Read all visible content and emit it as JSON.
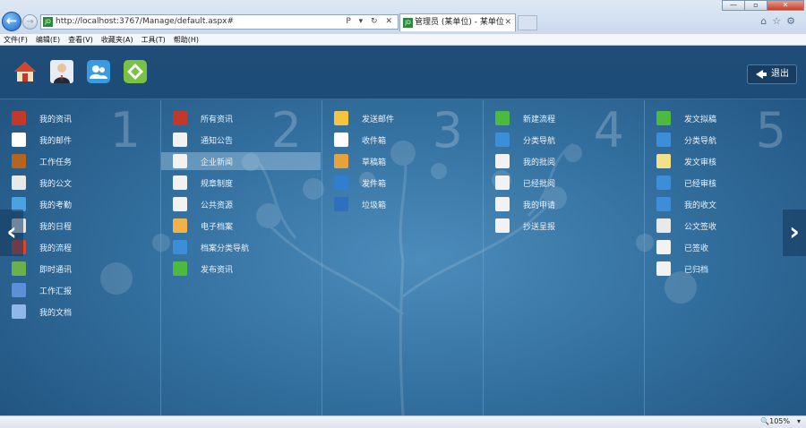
{
  "browser": {
    "address": "http://localhost:3767/Manage/default.aspx#",
    "address_tools": "P ▾ ↻ ✕",
    "tab_title": "管理员 (某单位) - 某单位",
    "tab_close": "✕",
    "favicon": "JD",
    "win_min": "—",
    "win_max": "▫",
    "win_close": "✕",
    "tool_icons": "⌂☆⚙",
    "back": "←",
    "forward": "→",
    "menu": [
      "文件(F)",
      "编辑(E)",
      "查看(V)",
      "收藏夹(A)",
      "工具(T)",
      "帮助(H)"
    ],
    "zoom": "🔍105%",
    "zoom_caret": "▾"
  },
  "app": {
    "exit_label": "退出",
    "prev_arrow": "‹",
    "next_arrow": "›",
    "top_icons": [
      "home-icon",
      "user-avatar-icon",
      "contacts-icon",
      "apps-icon"
    ],
    "columns": [
      {
        "number": "1",
        "items": [
          {
            "label": "我的资讯",
            "icon": "news-icon",
            "color": "#c0392b"
          },
          {
            "label": "我的邮件",
            "icon": "mail-icon",
            "color": "#ffffff"
          },
          {
            "label": "工作任务",
            "icon": "briefcase-icon",
            "color": "#b5651d"
          },
          {
            "label": "我的公文",
            "icon": "document-edit-icon",
            "color": "#e9e9e9"
          },
          {
            "label": "我的考勤",
            "icon": "clock-icon",
            "color": "#4aa3df"
          },
          {
            "label": "我的日程",
            "icon": "calendar-icon",
            "color": "#dfe6ee"
          },
          {
            "label": "我的流程",
            "icon": "flow-icon",
            "color": "#d14836"
          },
          {
            "label": "即时通讯",
            "icon": "chat-icon",
            "color": "#6ab04c"
          },
          {
            "label": "工作汇报",
            "icon": "report-icon",
            "color": "#5b8fd6"
          },
          {
            "label": "我的文档",
            "icon": "files-icon",
            "color": "#8fb8e8"
          }
        ]
      },
      {
        "number": "2",
        "items": [
          {
            "label": "所有资讯",
            "icon": "news-icon",
            "color": "#c0392b"
          },
          {
            "label": "通知公告",
            "icon": "notice-icon",
            "color": "#f2f2f2"
          },
          {
            "label": "企业新闻",
            "icon": "news-page-icon",
            "color": "#f2f2f2",
            "selected": true
          },
          {
            "label": "规章制度",
            "icon": "rules-icon",
            "color": "#f2f2f2"
          },
          {
            "label": "公共资源",
            "icon": "resource-icon",
            "color": "#f2f2f2"
          },
          {
            "label": "电子档案",
            "icon": "archive-icon",
            "color": "#f0b24a"
          },
          {
            "label": "档案分类导航",
            "icon": "archive-nav-icon",
            "color": "#3d8ed8"
          },
          {
            "label": "发布资讯",
            "icon": "add-icon",
            "color": "#4cba3e"
          }
        ]
      },
      {
        "number": "3",
        "items": [
          {
            "label": "发送邮件",
            "icon": "send-mail-icon",
            "color": "#f5c542"
          },
          {
            "label": "收件箱",
            "icon": "inbox-icon",
            "color": "#ffffff"
          },
          {
            "label": "草稿箱",
            "icon": "draft-icon",
            "color": "#e8a23b"
          },
          {
            "label": "发件箱",
            "icon": "outbox-icon",
            "color": "#2f7fd0"
          },
          {
            "label": "垃圾箱",
            "icon": "trash-icon",
            "color": "#2e6fbf"
          }
        ]
      },
      {
        "number": "4",
        "items": [
          {
            "label": "新建流程",
            "icon": "add-icon",
            "color": "#4cba3e"
          },
          {
            "label": "分类导航",
            "icon": "category-nav-icon",
            "color": "#3d8ed8"
          },
          {
            "label": "我的批阅",
            "icon": "review-icon",
            "color": "#f2f2f2"
          },
          {
            "label": "已经批阅",
            "icon": "reviewed-icon",
            "color": "#f2f2f2"
          },
          {
            "label": "我的申请",
            "icon": "application-icon",
            "color": "#f2f2f2"
          },
          {
            "label": "抄送呈报",
            "icon": "cc-icon",
            "color": "#f2f2f2"
          }
        ]
      },
      {
        "number": "5",
        "items": [
          {
            "label": "发文拟稿",
            "icon": "add-icon",
            "color": "#4cba3e"
          },
          {
            "label": "分类导航",
            "icon": "category-nav-icon",
            "color": "#3d8ed8"
          },
          {
            "label": "发文审核",
            "icon": "audit-icon",
            "color": "#f5e08a"
          },
          {
            "label": "已经审核",
            "icon": "audited-icon",
            "color": "#3d8ed8"
          },
          {
            "label": "我的收文",
            "icon": "received-doc-icon",
            "color": "#3d8ed8"
          },
          {
            "label": "公文签收",
            "icon": "sign-icon",
            "color": "#e9e9e9"
          },
          {
            "label": "已签收",
            "icon": "signed-icon",
            "color": "#f2f2f2"
          },
          {
            "label": "已归档",
            "icon": "archived-icon",
            "color": "#f2f2f2"
          }
        ]
      }
    ]
  }
}
